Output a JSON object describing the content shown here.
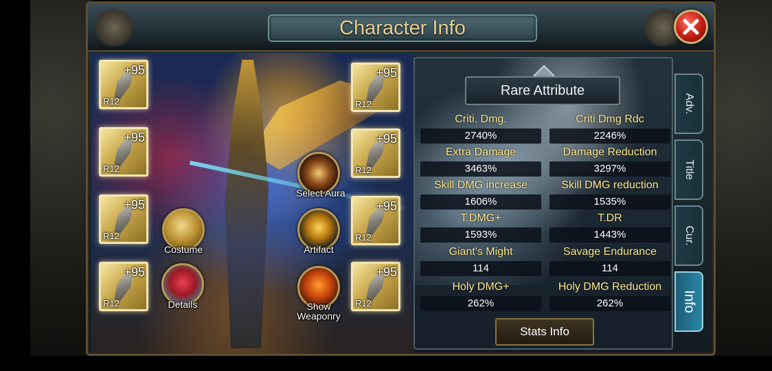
{
  "window": {
    "title": "Character Info"
  },
  "equipment": {
    "left": [
      {
        "enhance": "+95",
        "rank": "R12"
      },
      {
        "enhance": "+95",
        "rank": "R12"
      },
      {
        "enhance": "+95",
        "rank": "R12"
      },
      {
        "enhance": "+95",
        "rank": "R12"
      }
    ],
    "right": [
      {
        "enhance": "+95",
        "rank": "R12"
      },
      {
        "enhance": "+95",
        "rank": "R12"
      },
      {
        "enhance": "+95",
        "rank": "R12"
      },
      {
        "enhance": "+95",
        "rank": "R12"
      }
    ]
  },
  "buttons": {
    "costume": "Costume",
    "details": "Details",
    "select_aura": "Select Aura",
    "artifact": "Artifact",
    "show_weaponry": "Show Weaponry",
    "stats_info": "Stats Info"
  },
  "rare_attribute": {
    "title": "Rare Attribute",
    "rows": [
      {
        "left": {
          "name": "Criti. Dmg.",
          "value": "2740%"
        },
        "right": {
          "name": "Criti Dmg Rdc",
          "value": "2246%"
        }
      },
      {
        "left": {
          "name": "Extra Damage",
          "value": "3463%"
        },
        "right": {
          "name": "Damage Reduction",
          "value": "3297%"
        }
      },
      {
        "left": {
          "name": "Skill DMG increase",
          "value": "1606%"
        },
        "right": {
          "name": "Skill DMG reduction",
          "value": "1535%"
        }
      },
      {
        "left": {
          "name": "T.DMG+",
          "value": "1593%"
        },
        "right": {
          "name": "T.DR",
          "value": "1443%"
        }
      },
      {
        "left": {
          "name": "Giant's Might",
          "value": "114"
        },
        "right": {
          "name": "Savage Endurance",
          "value": "114"
        }
      },
      {
        "left": {
          "name": "Holy DMG+",
          "value": "262%"
        },
        "right": {
          "name": "Holy DMG Reduction",
          "value": "262%"
        }
      }
    ]
  },
  "tabs": [
    "Adv.",
    "Title",
    "Cur.",
    "Info"
  ],
  "active_tab": "Info",
  "colors": {
    "title_gold": "#e8cf8e",
    "attr_name_yellow": "#ffe98f",
    "active_tab_blue": "#2a86a6"
  }
}
